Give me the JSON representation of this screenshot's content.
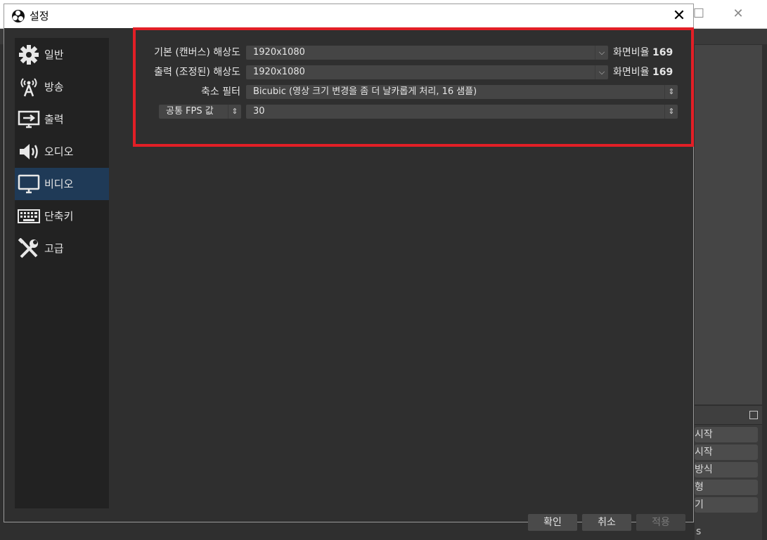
{
  "dialog": {
    "title": "설정",
    "close_glyph": "✕"
  },
  "sidebar": {
    "items": [
      {
        "label": "일반",
        "icon": "gear-icon"
      },
      {
        "label": "방송",
        "icon": "broadcast-antenna-icon"
      },
      {
        "label": "출력",
        "icon": "output-monitor-icon"
      },
      {
        "label": "오디오",
        "icon": "speaker-icon"
      },
      {
        "label": "비디오",
        "icon": "monitor-icon",
        "active": true
      },
      {
        "label": "단축키",
        "icon": "keyboard-icon"
      },
      {
        "label": "고급",
        "icon": "tools-icon"
      }
    ]
  },
  "video": {
    "base_resolution": {
      "label": "기본 (캔버스) 해상도",
      "value": "1920x1080",
      "ratio_label": "화면비율",
      "ratio_value": "169"
    },
    "output_resolution": {
      "label": "출력 (조정된) 해상도",
      "value": "1920x1080",
      "ratio_label": "화면비율",
      "ratio_value": "169"
    },
    "downscale_filter": {
      "label": "축소 필터",
      "value": "Bicubic (영상 크기 변경을 좀 더 날카롭게 처리, 16 샘플)"
    },
    "fps": {
      "label": "공통 FPS 값",
      "value": "30"
    }
  },
  "buttons": {
    "ok": "확인",
    "cancel": "취소",
    "apply": "적용"
  },
  "background": {
    "controls": [
      "시작",
      "시작",
      "방식",
      "형",
      "기"
    ],
    "status_text": "s"
  },
  "colors": {
    "highlight": "#e21f26",
    "active_item": "#1f3a57"
  }
}
